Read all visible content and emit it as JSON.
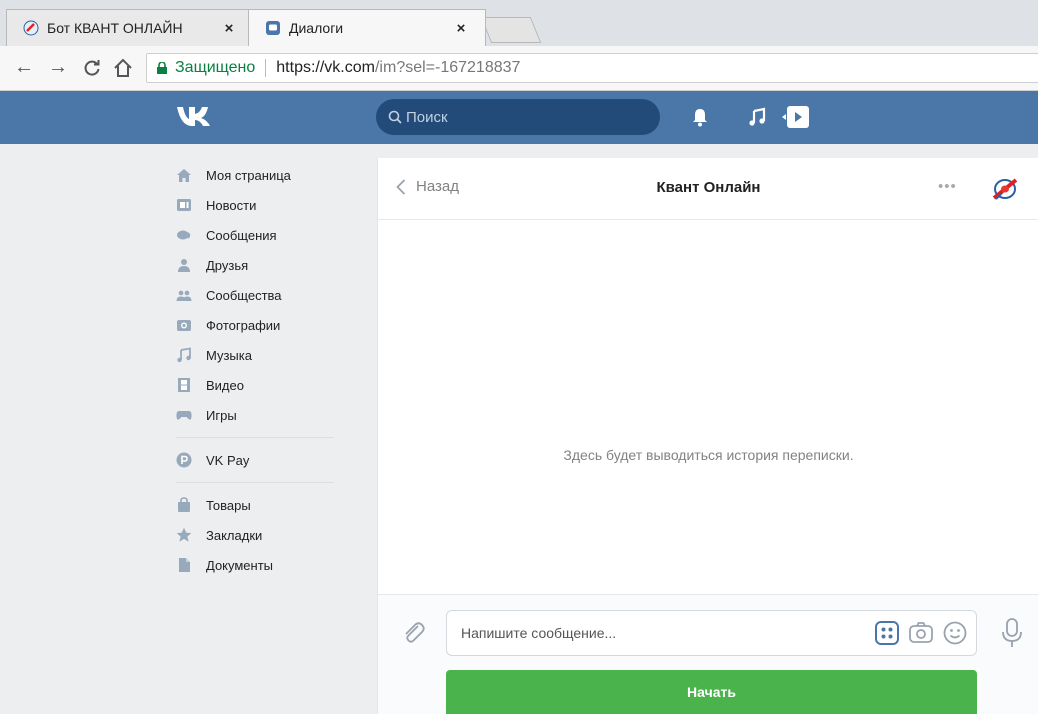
{
  "browser": {
    "tabs": [
      {
        "title": "Бот КВАНТ ОНЛАЙН",
        "close": "×"
      },
      {
        "title": "Диалоги",
        "close": "×"
      }
    ],
    "secure_label": "Защищено",
    "url_host": "https://vk.com",
    "url_path": "/im?sel=-167218837"
  },
  "header": {
    "search_placeholder": "Поиск"
  },
  "sidebar": {
    "items": [
      {
        "label": "Моя страница",
        "icon": "home-icon"
      },
      {
        "label": "Новости",
        "icon": "news-icon"
      },
      {
        "label": "Сообщения",
        "icon": "messages-icon"
      },
      {
        "label": "Друзья",
        "icon": "friends-icon"
      },
      {
        "label": "Сообщества",
        "icon": "groups-icon"
      },
      {
        "label": "Фотографии",
        "icon": "photo-icon"
      },
      {
        "label": "Музыка",
        "icon": "music-icon"
      },
      {
        "label": "Видео",
        "icon": "video-icon"
      },
      {
        "label": "Игры",
        "icon": "games-icon"
      }
    ],
    "pay": {
      "label": "VK Pay",
      "icon": "vkpay-icon"
    },
    "extra": [
      {
        "label": "Товары",
        "icon": "shopping-bag-icon"
      },
      {
        "label": "Закладки",
        "icon": "star-icon"
      },
      {
        "label": "Документы",
        "icon": "document-icon"
      }
    ]
  },
  "chat": {
    "back_label": "Назад",
    "title": "Квант Онлайн",
    "more": "•••",
    "empty_text": "Здесь будет выводиться история переписки.",
    "message_placeholder": "Напишите сообщение...",
    "start_button": "Начать"
  },
  "colors": {
    "vk_blue": "#4a76a8",
    "search_bg": "#224b7a",
    "start_green": "#4bb34b",
    "secure_green": "#0b8043"
  }
}
